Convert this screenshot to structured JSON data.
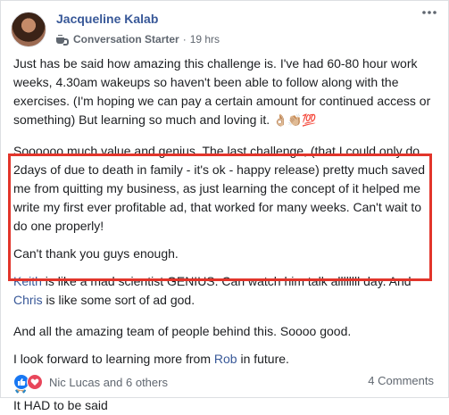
{
  "post": {
    "author": "Jacqueline Kalab",
    "role": "Conversation Starter",
    "time": "19 hrs",
    "paragraphs": [
      "Just has be said how amazing this challenge is. I've had 60-80 hour work weeks, 4.30am wakeups so haven't been able to follow along with the exercises. (I'm hoping we can pay a certain amount for continued access or something) But learning so much and loving it.",
      "Soooooo much value and genius. The last challenge, (that I could only do 2days of due to death in family - it's ok - happy release) pretty much saved me from quitting my business, as just learning the concept of it helped me write my first ever profitable ad, that worked for many weeks. Can't wait to do one properly!",
      "Can't thank you guys enough.",
      "Keith",
      " is like a mad scientist GENIUS. Can watch him talk allllllll day. And ",
      "Chris",
      " is like some sort of ad god.",
      "And all the amazing team of people behind this. Soooo good.",
      "I look forward to learning more from ",
      "Rob",
      " in future.",
      "It HAD to be said"
    ],
    "emojis_line1": "👌🏼👏🏼💯",
    "emoji_pray": "🙏🏼"
  },
  "footer": {
    "reactions": "Nic Lucas and 6 others",
    "comments": "4 Comments"
  },
  "colors": {
    "link": "#385898",
    "highlight": "#e2352b",
    "like": "#1877f2",
    "love": "#e8465b"
  }
}
